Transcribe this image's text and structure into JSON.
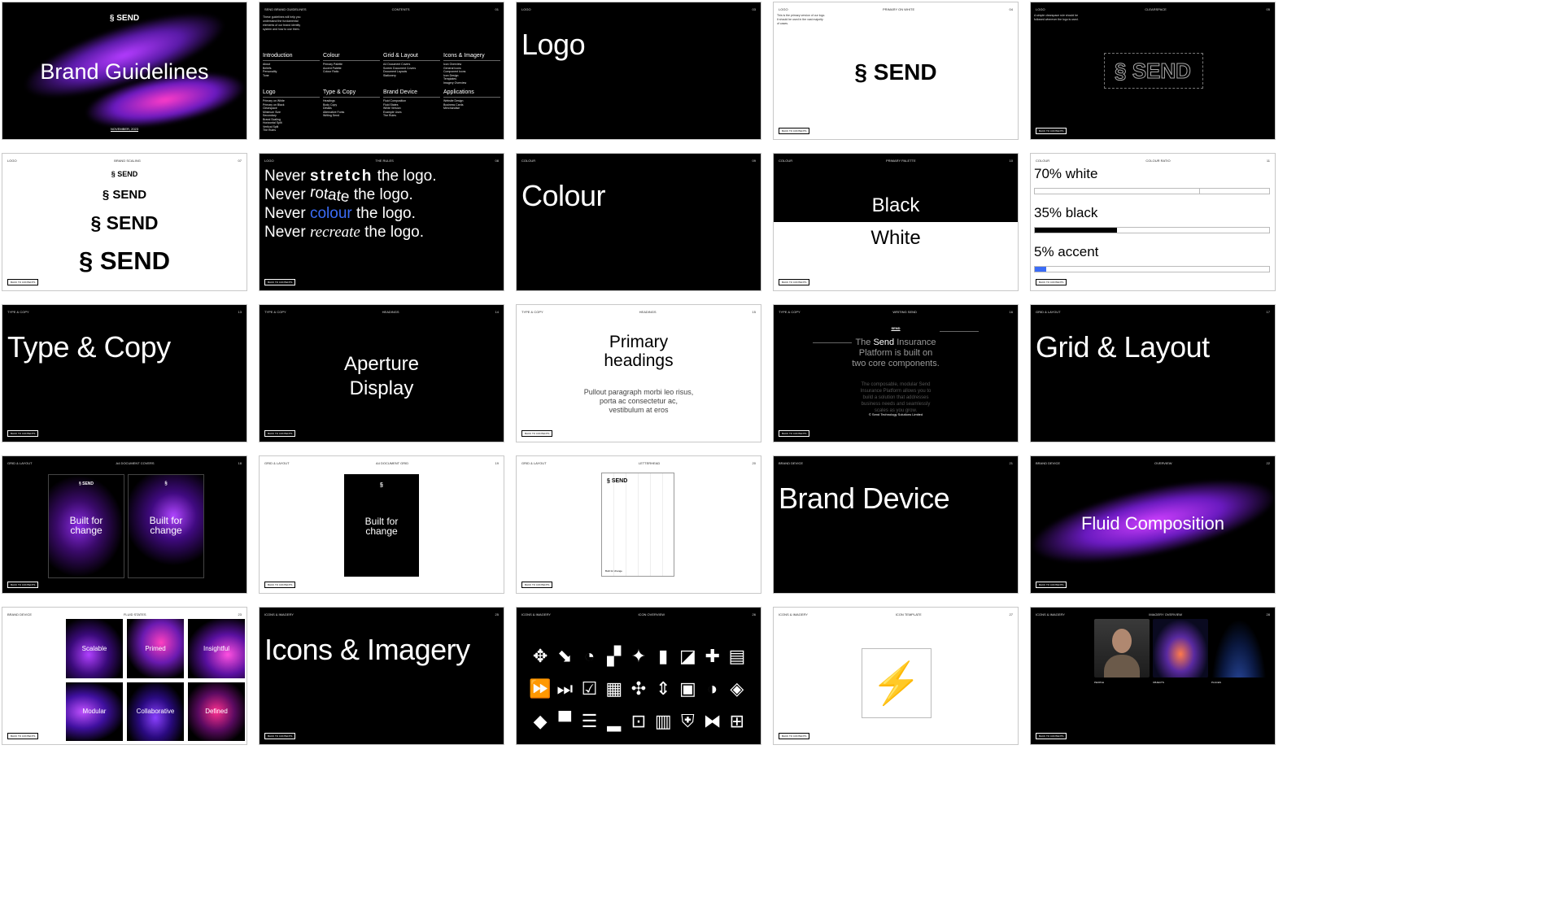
{
  "brand": "SEND",
  "slides": {
    "cover": {
      "title": "Brand Guidelines",
      "date": "NOVEMBER, 2023"
    },
    "contents": {
      "meta_left": "SEND BRAND GUIDELINES",
      "meta_mid": "CONTENTS",
      "intro": "These guidelines will help you understand the fundamental elements of our brand identity system and how to use them.",
      "sections": [
        {
          "title": "Introduction",
          "items": [
            "About",
            "Beliefs",
            "Personality",
            "Tone"
          ]
        },
        {
          "title": "Colour",
          "items": [
            "Primary Palette",
            "Accent Palette",
            "Colour Ratio"
          ]
        },
        {
          "title": "Grid & Layout",
          "items": [
            "A4 Document Covers",
            "Screen Document Covers",
            "Document Layouts",
            "Stationery"
          ]
        },
        {
          "title": "Icons & Imagery",
          "items": [
            "Icon Overview",
            "General Icons",
            "Component Icons",
            "Icon Design",
            "Templates",
            "Imagery Overview"
          ]
        },
        {
          "title": "Logo",
          "items": [
            "Primary on White",
            "Primary on Black",
            "Clearspace",
            "Minimum Size",
            "Secondary",
            "Brand Scaling",
            "Horizontal Split",
            "Vertical Split",
            "The Rules"
          ]
        },
        {
          "title": "Type & Copy",
          "items": [
            "Headings",
            "Body Copy",
            "Details",
            "Alternative Fonts",
            "Writing Send"
          ]
        },
        {
          "title": "Brand Device",
          "items": [
            "Fluid Composition",
            "Fluid States",
            "White Version",
            "Example Uses",
            "The Rules"
          ]
        },
        {
          "title": "Applications",
          "items": [
            "Website Design",
            "Business Cards",
            "Merchandise"
          ]
        }
      ]
    },
    "logo_title": {
      "title": "Logo"
    },
    "logo_white": {
      "meta_left": "LOGO",
      "meta_mid": "PRIMARY ON WHITE",
      "text": "This is the primary version of our logo. It should be used in the vast majority of cases."
    },
    "logo_clearspace": {
      "meta_left": "LOGO",
      "meta_mid": "CLEARSPACE",
      "text": "A simple clearspace rule should be followed wherever the logo is used."
    },
    "logo_scaling": {
      "meta_left": "LOGO",
      "meta_mid": "BRAND SCALING"
    },
    "rules": {
      "meta_left": "LOGO",
      "meta_mid": "THE RULES",
      "lines": [
        {
          "a": "Never ",
          "b": "stretch",
          "c": " the logo."
        },
        {
          "a": "Never ",
          "b": "rotate",
          "c": " the logo."
        },
        {
          "a": "Never ",
          "b": "colour",
          "c": " the logo."
        },
        {
          "a": "Never ",
          "b": "recreate",
          "c": " the logo."
        }
      ]
    },
    "colour_title": {
      "title": "Colour"
    },
    "palette": {
      "meta_left": "COLOUR",
      "meta_mid": "PRIMARY PALETTE",
      "black": "Black",
      "white": "White"
    },
    "ratio": {
      "meta_left": "COLOUR",
      "meta_mid": "COLOUR RATIO",
      "rows": [
        {
          "label": "70% white",
          "value": 0.7,
          "color": "#ffffff"
        },
        {
          "label": "35% black",
          "value": 0.35,
          "color": "#000000"
        },
        {
          "label": "5% accent",
          "value": 0.05,
          "color": "#3b6cf6"
        }
      ]
    },
    "type_title": {
      "title": "Type & Copy"
    },
    "aperture": {
      "meta_left": "TYPE & COPY",
      "meta_mid": "HEADINGS",
      "title_line1": "Aperture",
      "title_line2": "Display"
    },
    "primary_headings": {
      "meta_left": "TYPE & COPY",
      "meta_mid": "HEADINGS",
      "h1": "Primary",
      "h2": "headings",
      "body": "Pullout paragraph morbi leo risus, porta ac consectetur ac, vestibulum at eros"
    },
    "writing": {
      "meta_left": "TYPE & COPY",
      "meta_mid": "WRITING SEND",
      "head": "SEND",
      "p1a": "The ",
      "p1b": "Send",
      "p1c": " Insurance Platform is built on two core components.",
      "p2": "The composable, modular Send Insurance Platform allows you to build a solution that addresses business needs and seamlessly scales as you grow.",
      "footer": "© Send Technology Solutions Limited"
    },
    "grid_title": {
      "title": "Grid & Layout"
    },
    "a4_covers": {
      "meta_left": "GRID & LAYOUT",
      "meta_mid": "A4 DOCUMENT COVERS",
      "tagline": "Built for change"
    },
    "a4_grid": {
      "meta_left": "GRID & LAYOUT",
      "meta_mid": "A4 DOCUMENT GRID",
      "tagline": "Built for change"
    },
    "letterhead": {
      "meta_left": "GRID & LAYOUT",
      "meta_mid": "LETTERHEAD",
      "footer": "Built for change"
    },
    "device_title": {
      "title": "Brand Device"
    },
    "fluid": {
      "meta_left": "BRAND DEVICE",
      "meta_mid": "OVERVIEW",
      "title": "Fluid Composition"
    },
    "fluid_states": {
      "meta_left": "BRAND DEVICE",
      "meta_mid": "FLUID STATES",
      "tiles": [
        "Scalable",
        "Primed",
        "Insightful",
        "Modular",
        "Collaborative",
        "Defined"
      ]
    },
    "icons_title": {
      "title": "Icons & Imagery"
    },
    "icons_overview": {
      "meta_left": "ICONS & IMAGERY",
      "meta_mid": "ICON OVERVIEW",
      "glyphs": [
        "✥",
        "⬊",
        "◔",
        "▞",
        "✦",
        "▮",
        "◪",
        "✚",
        "▤",
        "⏩",
        "⏭",
        "☑",
        "▦",
        "✣",
        "⇕",
        "▣",
        "◑",
        "◈",
        "◆",
        "▀",
        "☰",
        "▂",
        "⊡",
        "▥",
        "⛨",
        "⧓",
        "⊞"
      ]
    },
    "icon_template": {
      "meta_left": "ICONS & IMAGERY",
      "meta_mid": "ICON TEMPLATE"
    },
    "imagery": {
      "meta_left": "ICONS & IMAGERY",
      "meta_mid": "IMAGERY OVERVIEW",
      "captions": [
        "PEOPLE",
        "OBJECTS",
        "PLACES"
      ]
    },
    "back_label": "BACK TO CONTENTS"
  }
}
